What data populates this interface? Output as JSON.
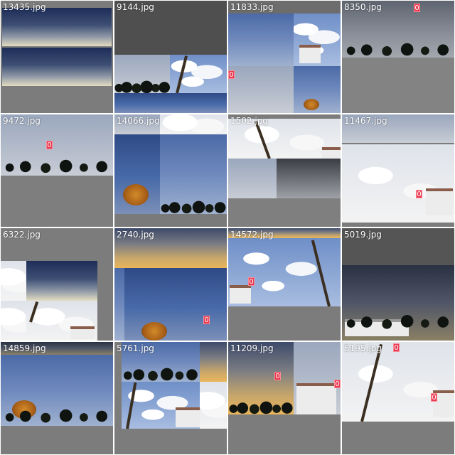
{
  "tiles": [
    {
      "filename": "13435.jpg",
      "label": ""
    },
    {
      "filename": "9144.jpg",
      "label": ""
    },
    {
      "filename": "11833.jpg",
      "label": "0"
    },
    {
      "filename": "8350.jpg",
      "label": "0"
    },
    {
      "filename": "9472.jpg",
      "label": "0"
    },
    {
      "filename": "14066.jpg",
      "label": ""
    },
    {
      "filename": "1502.jpg",
      "label": ""
    },
    {
      "filename": "11467.jpg",
      "label": "0"
    },
    {
      "filename": "6322.jpg",
      "label": ""
    },
    {
      "filename": "2740.jpg",
      "label": "0"
    },
    {
      "filename": "14572.jpg",
      "label": "0"
    },
    {
      "filename": "5019.jpg",
      "label": ""
    },
    {
      "filename": "14859.jpg",
      "label": ""
    },
    {
      "filename": "5761.jpg",
      "label": ""
    },
    {
      "filename": "11209.jpg",
      "label": "0"
    },
    {
      "filename": "5195.jpg",
      "label": "0"
    }
  ],
  "colors": {
    "tag": "#e8384f",
    "background": "#7c7c7c"
  }
}
